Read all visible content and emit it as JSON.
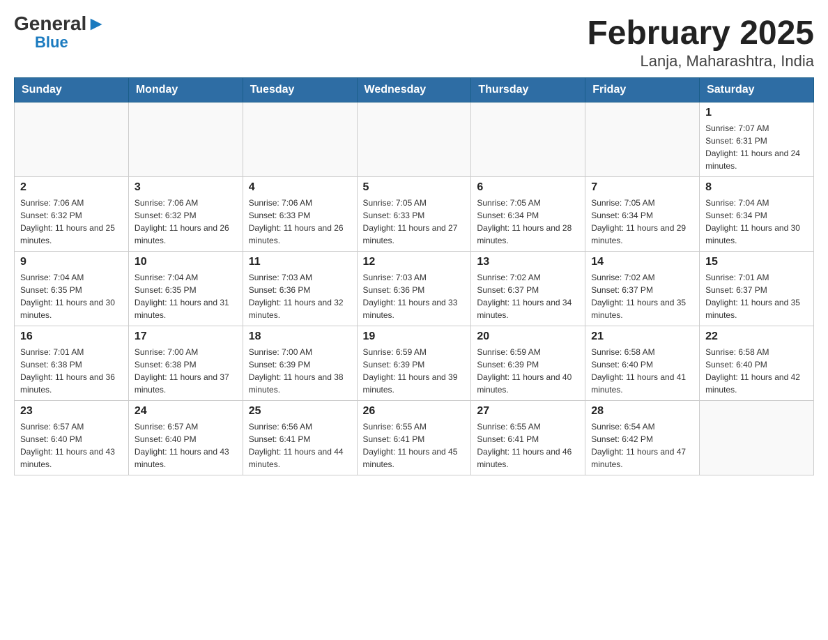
{
  "header": {
    "logo_general": "General",
    "logo_blue": "Blue",
    "title": "February 2025",
    "subtitle": "Lanja, Maharashtra, India"
  },
  "weekdays": [
    "Sunday",
    "Monday",
    "Tuesday",
    "Wednesday",
    "Thursday",
    "Friday",
    "Saturday"
  ],
  "weeks": [
    [
      {
        "day": "",
        "info": ""
      },
      {
        "day": "",
        "info": ""
      },
      {
        "day": "",
        "info": ""
      },
      {
        "day": "",
        "info": ""
      },
      {
        "day": "",
        "info": ""
      },
      {
        "day": "",
        "info": ""
      },
      {
        "day": "1",
        "info": "Sunrise: 7:07 AM\nSunset: 6:31 PM\nDaylight: 11 hours and 24 minutes."
      }
    ],
    [
      {
        "day": "2",
        "info": "Sunrise: 7:06 AM\nSunset: 6:32 PM\nDaylight: 11 hours and 25 minutes."
      },
      {
        "day": "3",
        "info": "Sunrise: 7:06 AM\nSunset: 6:32 PM\nDaylight: 11 hours and 26 minutes."
      },
      {
        "day": "4",
        "info": "Sunrise: 7:06 AM\nSunset: 6:33 PM\nDaylight: 11 hours and 26 minutes."
      },
      {
        "day": "5",
        "info": "Sunrise: 7:05 AM\nSunset: 6:33 PM\nDaylight: 11 hours and 27 minutes."
      },
      {
        "day": "6",
        "info": "Sunrise: 7:05 AM\nSunset: 6:34 PM\nDaylight: 11 hours and 28 minutes."
      },
      {
        "day": "7",
        "info": "Sunrise: 7:05 AM\nSunset: 6:34 PM\nDaylight: 11 hours and 29 minutes."
      },
      {
        "day": "8",
        "info": "Sunrise: 7:04 AM\nSunset: 6:34 PM\nDaylight: 11 hours and 30 minutes."
      }
    ],
    [
      {
        "day": "9",
        "info": "Sunrise: 7:04 AM\nSunset: 6:35 PM\nDaylight: 11 hours and 30 minutes."
      },
      {
        "day": "10",
        "info": "Sunrise: 7:04 AM\nSunset: 6:35 PM\nDaylight: 11 hours and 31 minutes."
      },
      {
        "day": "11",
        "info": "Sunrise: 7:03 AM\nSunset: 6:36 PM\nDaylight: 11 hours and 32 minutes."
      },
      {
        "day": "12",
        "info": "Sunrise: 7:03 AM\nSunset: 6:36 PM\nDaylight: 11 hours and 33 minutes."
      },
      {
        "day": "13",
        "info": "Sunrise: 7:02 AM\nSunset: 6:37 PM\nDaylight: 11 hours and 34 minutes."
      },
      {
        "day": "14",
        "info": "Sunrise: 7:02 AM\nSunset: 6:37 PM\nDaylight: 11 hours and 35 minutes."
      },
      {
        "day": "15",
        "info": "Sunrise: 7:01 AM\nSunset: 6:37 PM\nDaylight: 11 hours and 35 minutes."
      }
    ],
    [
      {
        "day": "16",
        "info": "Sunrise: 7:01 AM\nSunset: 6:38 PM\nDaylight: 11 hours and 36 minutes."
      },
      {
        "day": "17",
        "info": "Sunrise: 7:00 AM\nSunset: 6:38 PM\nDaylight: 11 hours and 37 minutes."
      },
      {
        "day": "18",
        "info": "Sunrise: 7:00 AM\nSunset: 6:39 PM\nDaylight: 11 hours and 38 minutes."
      },
      {
        "day": "19",
        "info": "Sunrise: 6:59 AM\nSunset: 6:39 PM\nDaylight: 11 hours and 39 minutes."
      },
      {
        "day": "20",
        "info": "Sunrise: 6:59 AM\nSunset: 6:39 PM\nDaylight: 11 hours and 40 minutes."
      },
      {
        "day": "21",
        "info": "Sunrise: 6:58 AM\nSunset: 6:40 PM\nDaylight: 11 hours and 41 minutes."
      },
      {
        "day": "22",
        "info": "Sunrise: 6:58 AM\nSunset: 6:40 PM\nDaylight: 11 hours and 42 minutes."
      }
    ],
    [
      {
        "day": "23",
        "info": "Sunrise: 6:57 AM\nSunset: 6:40 PM\nDaylight: 11 hours and 43 minutes."
      },
      {
        "day": "24",
        "info": "Sunrise: 6:57 AM\nSunset: 6:40 PM\nDaylight: 11 hours and 43 minutes."
      },
      {
        "day": "25",
        "info": "Sunrise: 6:56 AM\nSunset: 6:41 PM\nDaylight: 11 hours and 44 minutes."
      },
      {
        "day": "26",
        "info": "Sunrise: 6:55 AM\nSunset: 6:41 PM\nDaylight: 11 hours and 45 minutes."
      },
      {
        "day": "27",
        "info": "Sunrise: 6:55 AM\nSunset: 6:41 PM\nDaylight: 11 hours and 46 minutes."
      },
      {
        "day": "28",
        "info": "Sunrise: 6:54 AM\nSunset: 6:42 PM\nDaylight: 11 hours and 47 minutes."
      },
      {
        "day": "",
        "info": ""
      }
    ]
  ]
}
